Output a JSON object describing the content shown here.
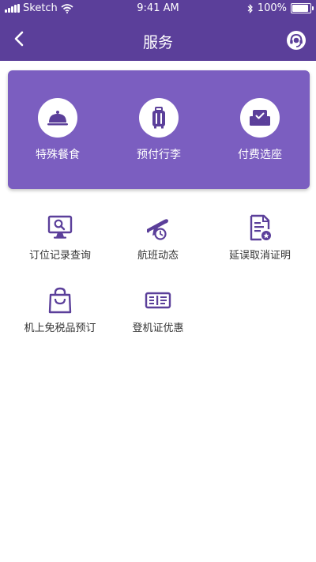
{
  "status_bar": {
    "carrier": "Sketch",
    "time": "9:41 AM",
    "battery": "100%"
  },
  "nav": {
    "title": "服务"
  },
  "featured": [
    {
      "label": "特殊餐食",
      "icon": "cloche-icon"
    },
    {
      "label": "预付行李",
      "icon": "luggage-icon"
    },
    {
      "label": "付费选座",
      "icon": "seat-icon"
    }
  ],
  "services": [
    {
      "label": "订位记录查询",
      "icon": "monitor-search-icon"
    },
    {
      "label": "航班动态",
      "icon": "plane-clock-icon"
    },
    {
      "label": "延误取消证明",
      "icon": "certificate-icon"
    },
    {
      "label": "机上免税品预订",
      "icon": "shopping-bag-icon"
    },
    {
      "label": "登机证优惠",
      "icon": "ticket-icon"
    }
  ],
  "colors": {
    "header": "#5b3f9a",
    "card": "#7b5ec0",
    "icon": "#5b3f9a"
  }
}
